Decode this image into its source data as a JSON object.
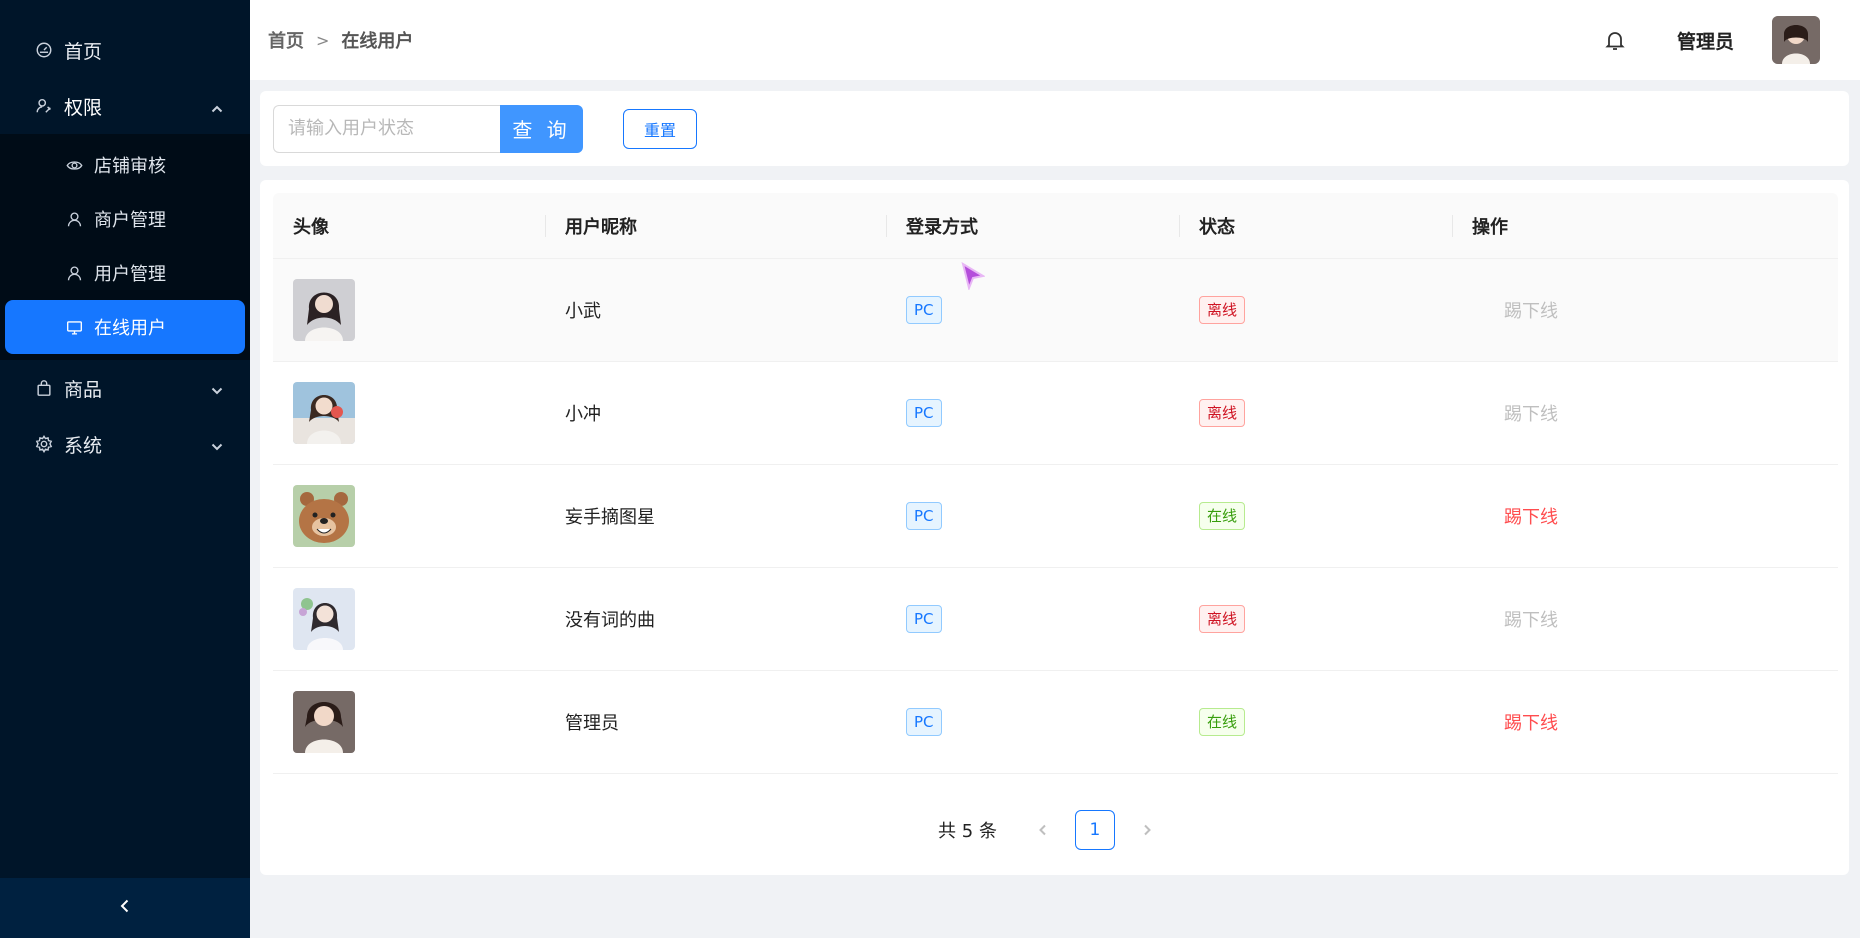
{
  "sidebar": {
    "items": [
      {
        "label": "首页",
        "icon": "dashboard-icon"
      },
      {
        "label": "权限",
        "icon": "permission-icon",
        "expanded": true
      },
      {
        "label": "商品",
        "icon": "shopping-bag-icon"
      },
      {
        "label": "系统",
        "icon": "gear-icon"
      }
    ],
    "permission_children": [
      {
        "label": "店铺审核",
        "icon": "eye-icon"
      },
      {
        "label": "商户管理",
        "icon": "user-icon"
      },
      {
        "label": "用户管理",
        "icon": "user-icon"
      },
      {
        "label": "在线用户",
        "icon": "monitor-icon",
        "active": true
      }
    ]
  },
  "header": {
    "breadcrumb": [
      "首页",
      "在线用户"
    ],
    "breadcrumb_sep": ">",
    "user_name": "管理员"
  },
  "search": {
    "placeholder": "请输入用户状态",
    "value": "",
    "query_label": "查 询",
    "reset_label": "重置"
  },
  "table": {
    "columns": [
      "头像",
      "用户昵称",
      "登录方式",
      "状态",
      "操作"
    ],
    "rows": [
      {
        "nickname": "小武",
        "login": "PC",
        "status": "离线",
        "action": "踢下线"
      },
      {
        "nickname": "小冲",
        "login": "PC",
        "status": "离线",
        "action": "踢下线"
      },
      {
        "nickname": "妄手摘图星",
        "login": "PC",
        "status": "在线",
        "action": "踢下线"
      },
      {
        "nickname": "没有词的曲",
        "login": "PC",
        "status": "离线",
        "action": "踢下线"
      },
      {
        "nickname": "管理员",
        "login": "PC",
        "status": "在线",
        "action": "踢下线"
      }
    ]
  },
  "pagination": {
    "total_text": "共 5 条",
    "current_page": "1"
  },
  "colors": {
    "sidebar_bg": "#001529",
    "accent": "#1677ff",
    "offline": "#cf1322",
    "online": "#389e0d"
  }
}
